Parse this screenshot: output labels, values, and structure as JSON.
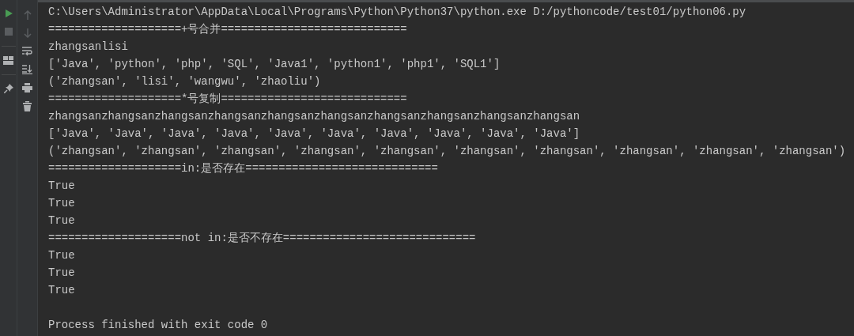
{
  "left_toolbar": [
    {
      "disabled": false
    },
    {
      "disabled": true
    },
    {
      "disabled": false
    },
    {
      "disabled": false
    }
  ],
  "right_toolbar": [
    {
      "disabled": true
    },
    {
      "disabled": true
    },
    {
      "disabled": false
    },
    {
      "disabled": false
    },
    {
      "disabled": false
    },
    {
      "disabled": false
    }
  ],
  "console": {
    "lines": [
      {
        "kind": "output",
        "text": "C:\\Users\\Administrator\\AppData\\Local\\Programs\\Python\\Python37\\python.exe D:/pythoncode/test01/python06.py"
      },
      {
        "kind": "output",
        "text": "====================+号合并============================"
      },
      {
        "kind": "output",
        "text": "zhangsanlisi"
      },
      {
        "kind": "output",
        "text": "['Java', 'python', 'php', 'SQL', 'Java1', 'python1', 'php1', 'SQL1']"
      },
      {
        "kind": "output",
        "text": "('zhangsan', 'lisi', 'wangwu', 'zhaoliu')"
      },
      {
        "kind": "output",
        "text": "====================*号复制============================"
      },
      {
        "kind": "output",
        "text": "zhangsanzhangsanzhangsanzhangsanzhangsanzhangsanzhangsanzhangsanzhangsanzhangsan"
      },
      {
        "kind": "output",
        "text": "['Java', 'Java', 'Java', 'Java', 'Java', 'Java', 'Java', 'Java', 'Java', 'Java']"
      },
      {
        "kind": "output",
        "text": "('zhangsan', 'zhangsan', 'zhangsan', 'zhangsan', 'zhangsan', 'zhangsan', 'zhangsan', 'zhangsan', 'zhangsan', 'zhangsan')"
      },
      {
        "kind": "output",
        "text": "====================in:是否存在============================="
      },
      {
        "kind": "output",
        "text": "True"
      },
      {
        "kind": "output",
        "text": "True"
      },
      {
        "kind": "output",
        "text": "True"
      },
      {
        "kind": "output",
        "text": "====================not in:是否不存在============================="
      },
      {
        "kind": "output",
        "text": "True"
      },
      {
        "kind": "output",
        "text": "True"
      },
      {
        "kind": "output",
        "text": "True"
      },
      {
        "kind": "exit",
        "text": "Process finished with exit code 0"
      }
    ]
  }
}
